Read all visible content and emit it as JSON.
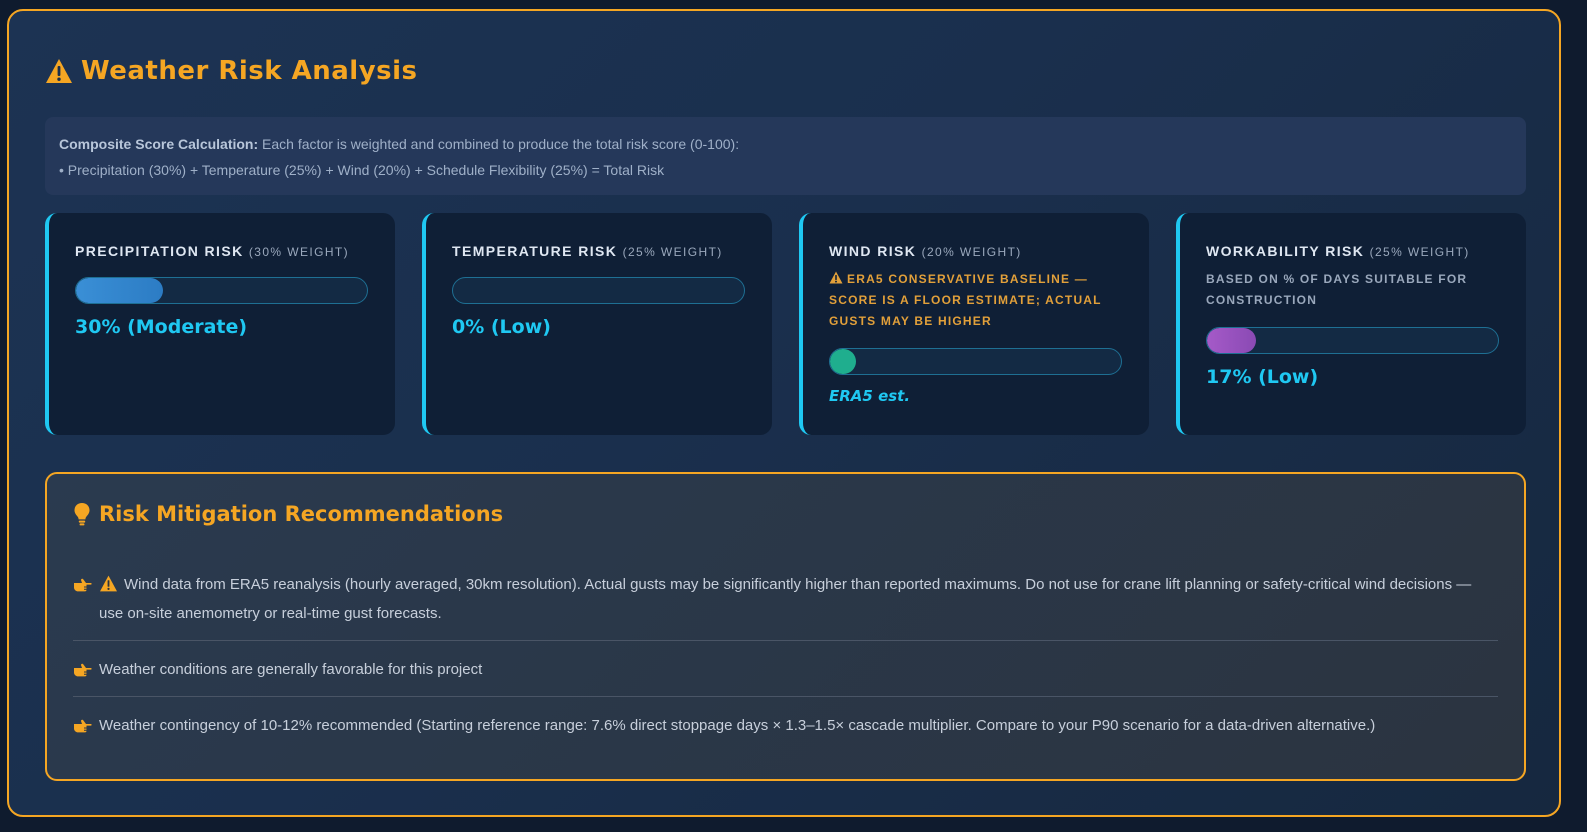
{
  "header": {
    "title": "Weather Risk Analysis",
    "icon": "warning-icon"
  },
  "formula": {
    "label": "Composite Score Calculation:",
    "description": " Each factor is weighted and combined to produce the total risk score (0-100):",
    "equation": "• Precipitation (30%) + Temperature (25%) + Wind (20%) + Schedule Flexibility (25%) = Total Risk"
  },
  "cards": [
    {
      "title": "Precipitation Risk",
      "weight": "(30% weight)",
      "note": "",
      "value_pct": 30,
      "fill_color": "#3a8fd6",
      "value_label": "30% (Moderate)"
    },
    {
      "title": "Temperature Risk",
      "weight": "(25% weight)",
      "note": "",
      "value_pct": 0,
      "fill_color": "#1fc8f2",
      "value_label": "0% (Low)"
    },
    {
      "title": "Wind Risk",
      "weight": "(20% weight)",
      "note": "ERA5 conservative baseline — score is a floor estimate; actual gusts may be higher",
      "value_label": "ERA5 est.",
      "fill_color": "#1fae8e"
    },
    {
      "title": "Workability Risk",
      "weight": "(25% weight)",
      "note": "Based on % of days suitable for construction",
      "value_pct": 17,
      "fill_color": "#a55ac8",
      "value_label": "17% (Low)"
    }
  ],
  "recommendations": {
    "title": "Risk Mitigation Recommendations",
    "icon": "lightbulb-icon",
    "items": [
      {
        "warning": true,
        "text": "Wind data from ERA5 reanalysis (hourly averaged, 30km resolution). Actual gusts may be significantly higher than reported maximums. Do not use for crane lift planning or safety-critical wind decisions — use on-site anemometry or real-time gust forecasts."
      },
      {
        "warning": false,
        "text": "Weather conditions are generally favorable for this project"
      },
      {
        "warning": false,
        "text": "Weather contingency of 10-12% recommended (Starting reference range: 7.6% direct stoppage days × 1.3–1.5× cascade multiplier. Compare to your P90 scenario for a data-driven alternative.)"
      }
    ]
  },
  "colors": {
    "accent": "#f5a623",
    "cyan": "#1fc8f2",
    "warning": "#e2a03a"
  }
}
